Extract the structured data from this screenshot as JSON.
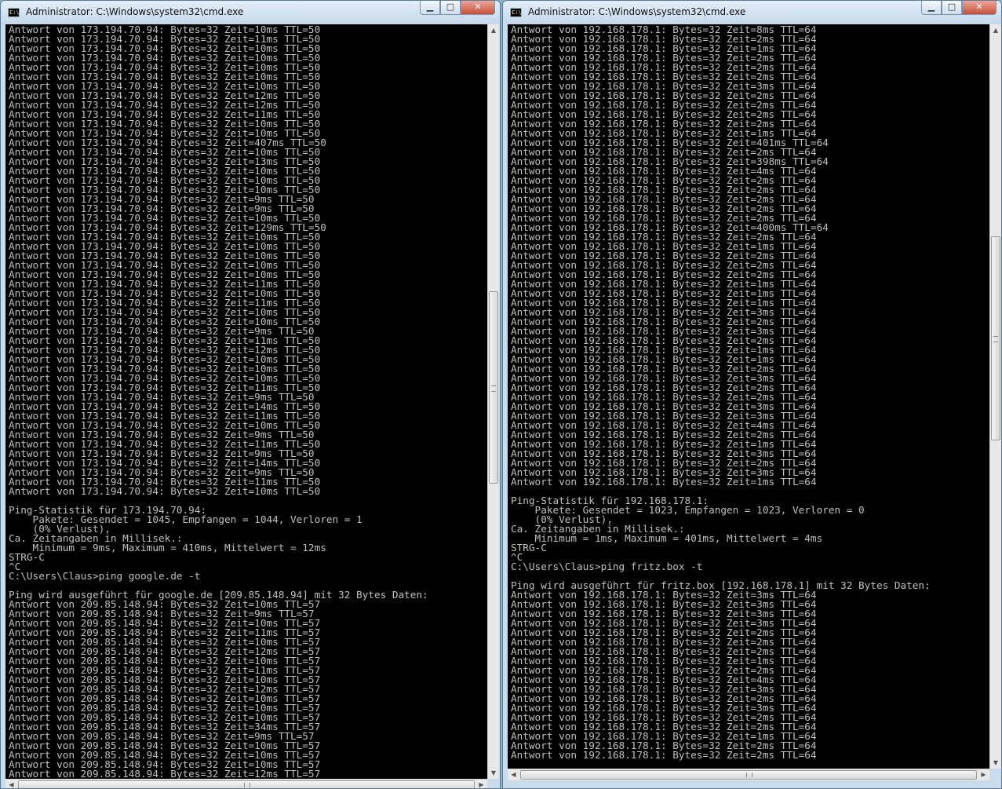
{
  "left": {
    "title": "Administrator: C:\\Windows\\system32\\cmd.exe",
    "lines": [
      "Antwort von 173.194.70.94: Bytes=32 Zeit=10ms TTL=50",
      "Antwort von 173.194.70.94: Bytes=32 Zeit=11ms TTL=50",
      "Antwort von 173.194.70.94: Bytes=32 Zeit=10ms TTL=50",
      "Antwort von 173.194.70.94: Bytes=32 Zeit=10ms TTL=50",
      "Antwort von 173.194.70.94: Bytes=32 Zeit=10ms TTL=50",
      "Antwort von 173.194.70.94: Bytes=32 Zeit=10ms TTL=50",
      "Antwort von 173.194.70.94: Bytes=32 Zeit=10ms TTL=50",
      "Antwort von 173.194.70.94: Bytes=32 Zeit=12ms TTL=50",
      "Antwort von 173.194.70.94: Bytes=32 Zeit=12ms TTL=50",
      "Antwort von 173.194.70.94: Bytes=32 Zeit=11ms TTL=50",
      "Antwort von 173.194.70.94: Bytes=32 Zeit=10ms TTL=50",
      "Antwort von 173.194.70.94: Bytes=32 Zeit=10ms TTL=50",
      "Antwort von 173.194.70.94: Bytes=32 Zeit=407ms TTL=50",
      "Antwort von 173.194.70.94: Bytes=32 Zeit=10ms TTL=50",
      "Antwort von 173.194.70.94: Bytes=32 Zeit=13ms TTL=50",
      "Antwort von 173.194.70.94: Bytes=32 Zeit=10ms TTL=50",
      "Antwort von 173.194.70.94: Bytes=32 Zeit=10ms TTL=50",
      "Antwort von 173.194.70.94: Bytes=32 Zeit=10ms TTL=50",
      "Antwort von 173.194.70.94: Bytes=32 Zeit=9ms TTL=50",
      "Antwort von 173.194.70.94: Bytes=32 Zeit=9ms TTL=50",
      "Antwort von 173.194.70.94: Bytes=32 Zeit=10ms TTL=50",
      "Antwort von 173.194.70.94: Bytes=32 Zeit=129ms TTL=50",
      "Antwort von 173.194.70.94: Bytes=32 Zeit=10ms TTL=50",
      "Antwort von 173.194.70.94: Bytes=32 Zeit=10ms TTL=50",
      "Antwort von 173.194.70.94: Bytes=32 Zeit=10ms TTL=50",
      "Antwort von 173.194.70.94: Bytes=32 Zeit=10ms TTL=50",
      "Antwort von 173.194.70.94: Bytes=32 Zeit=10ms TTL=50",
      "Antwort von 173.194.70.94: Bytes=32 Zeit=11ms TTL=50",
      "Antwort von 173.194.70.94: Bytes=32 Zeit=10ms TTL=50",
      "Antwort von 173.194.70.94: Bytes=32 Zeit=11ms TTL=50",
      "Antwort von 173.194.70.94: Bytes=32 Zeit=10ms TTL=50",
      "Antwort von 173.194.70.94: Bytes=32 Zeit=10ms TTL=50",
      "Antwort von 173.194.70.94: Bytes=32 Zeit=9ms TTL=50",
      "Antwort von 173.194.70.94: Bytes=32 Zeit=11ms TTL=50",
      "Antwort von 173.194.70.94: Bytes=32 Zeit=12ms TTL=50",
      "Antwort von 173.194.70.94: Bytes=32 Zeit=10ms TTL=50",
      "Antwort von 173.194.70.94: Bytes=32 Zeit=10ms TTL=50",
      "Antwort von 173.194.70.94: Bytes=32 Zeit=10ms TTL=50",
      "Antwort von 173.194.70.94: Bytes=32 Zeit=11ms TTL=50",
      "Antwort von 173.194.70.94: Bytes=32 Zeit=9ms TTL=50",
      "Antwort von 173.194.70.94: Bytes=32 Zeit=14ms TTL=50",
      "Antwort von 173.194.70.94: Bytes=32 Zeit=11ms TTL=50",
      "Antwort von 173.194.70.94: Bytes=32 Zeit=10ms TTL=50",
      "Antwort von 173.194.70.94: Bytes=32 Zeit=9ms TTL=50",
      "Antwort von 173.194.70.94: Bytes=32 Zeit=11ms TTL=50",
      "Antwort von 173.194.70.94: Bytes=32 Zeit=9ms TTL=50",
      "Antwort von 173.194.70.94: Bytes=32 Zeit=14ms TTL=50",
      "Antwort von 173.194.70.94: Bytes=32 Zeit=9ms TTL=50",
      "Antwort von 173.194.70.94: Bytes=32 Zeit=11ms TTL=50",
      "Antwort von 173.194.70.94: Bytes=32 Zeit=10ms TTL=50",
      "",
      "Ping-Statistik für 173.194.70.94:",
      "    Pakete: Gesendet = 1045, Empfangen = 1044, Verloren = 1",
      "    (0% Verlust),",
      "Ca. Zeitangaben in Millisek.:",
      "    Minimum = 9ms, Maximum = 410ms, Mittelwert = 12ms",
      "STRG-C",
      "^C",
      "C:\\Users\\Claus>ping google.de -t",
      "",
      "Ping wird ausgeführt für google.de [209.85.148.94] mit 32 Bytes Daten:",
      "Antwort von 209.85.148.94: Bytes=32 Zeit=10ms TTL=57",
      "Antwort von 209.85.148.94: Bytes=32 Zeit=9ms TTL=57",
      "Antwort von 209.85.148.94: Bytes=32 Zeit=10ms TTL=57",
      "Antwort von 209.85.148.94: Bytes=32 Zeit=11ms TTL=57",
      "Antwort von 209.85.148.94: Bytes=32 Zeit=10ms TTL=57",
      "Antwort von 209.85.148.94: Bytes=32 Zeit=12ms TTL=57",
      "Antwort von 209.85.148.94: Bytes=32 Zeit=10ms TTL=57",
      "Antwort von 209.85.148.94: Bytes=32 Zeit=11ms TTL=57",
      "Antwort von 209.85.148.94: Bytes=32 Zeit=10ms TTL=57",
      "Antwort von 209.85.148.94: Bytes=32 Zeit=12ms TTL=57",
      "Antwort von 209.85.148.94: Bytes=32 Zeit=10ms TTL=57",
      "Antwort von 209.85.148.94: Bytes=32 Zeit=10ms TTL=57",
      "Antwort von 209.85.148.94: Bytes=32 Zeit=10ms TTL=57",
      "Antwort von 209.85.148.94: Bytes=32 Zeit=34ms TTL=57",
      "Antwort von 209.85.148.94: Bytes=32 Zeit=9ms TTL=57",
      "Antwort von 209.85.148.94: Bytes=32 Zeit=10ms TTL=57",
      "Antwort von 209.85.148.94: Bytes=32 Zeit=10ms TTL=57",
      "Antwort von 209.85.148.94: Bytes=32 Zeit=10ms TTL=57",
      "Antwort von 209.85.148.94: Bytes=32 Zeit=12ms TTL=57"
    ]
  },
  "right": {
    "title": "Administrator: C:\\Windows\\system32\\cmd.exe",
    "lines": [
      "Antwort von 192.168.178.1: Bytes=32 Zeit=8ms TTL=64",
      "Antwort von 192.168.178.1: Bytes=32 Zeit=2ms TTL=64",
      "Antwort von 192.168.178.1: Bytes=32 Zeit=1ms TTL=64",
      "Antwort von 192.168.178.1: Bytes=32 Zeit=2ms TTL=64",
      "Antwort von 192.168.178.1: Bytes=32 Zeit=2ms TTL=64",
      "Antwort von 192.168.178.1: Bytes=32 Zeit=2ms TTL=64",
      "Antwort von 192.168.178.1: Bytes=32 Zeit=3ms TTL=64",
      "Antwort von 192.168.178.1: Bytes=32 Zeit=2ms TTL=64",
      "Antwort von 192.168.178.1: Bytes=32 Zeit=2ms TTL=64",
      "Antwort von 192.168.178.1: Bytes=32 Zeit=2ms TTL=64",
      "Antwort von 192.168.178.1: Bytes=32 Zeit=2ms TTL=64",
      "Antwort von 192.168.178.1: Bytes=32 Zeit=1ms TTL=64",
      "Antwort von 192.168.178.1: Bytes=32 Zeit=401ms TTL=64",
      "Antwort von 192.168.178.1: Bytes=32 Zeit=2ms TTL=64",
      "Antwort von 192.168.178.1: Bytes=32 Zeit=398ms TTL=64",
      "Antwort von 192.168.178.1: Bytes=32 Zeit=4ms TTL=64",
      "Antwort von 192.168.178.1: Bytes=32 Zeit=2ms TTL=64",
      "Antwort von 192.168.178.1: Bytes=32 Zeit=2ms TTL=64",
      "Antwort von 192.168.178.1: Bytes=32 Zeit=2ms TTL=64",
      "Antwort von 192.168.178.1: Bytes=32 Zeit=2ms TTL=64",
      "Antwort von 192.168.178.1: Bytes=32 Zeit=2ms TTL=64",
      "Antwort von 192.168.178.1: Bytes=32 Zeit=400ms TTL=64",
      "Antwort von 192.168.178.1: Bytes=32 Zeit=2ms TTL=64",
      "Antwort von 192.168.178.1: Bytes=32 Zeit=1ms TTL=64",
      "Antwort von 192.168.178.1: Bytes=32 Zeit=2ms TTL=64",
      "Antwort von 192.168.178.1: Bytes=32 Zeit=2ms TTL=64",
      "Antwort von 192.168.178.1: Bytes=32 Zeit=2ms TTL=64",
      "Antwort von 192.168.178.1: Bytes=32 Zeit=1ms TTL=64",
      "Antwort von 192.168.178.1: Bytes=32 Zeit=1ms TTL=64",
      "Antwort von 192.168.178.1: Bytes=32 Zeit=1ms TTL=64",
      "Antwort von 192.168.178.1: Bytes=32 Zeit=3ms TTL=64",
      "Antwort von 192.168.178.1: Bytes=32 Zeit=2ms TTL=64",
      "Antwort von 192.168.178.1: Bytes=32 Zeit=3ms TTL=64",
      "Antwort von 192.168.178.1: Bytes=32 Zeit=2ms TTL=64",
      "Antwort von 192.168.178.1: Bytes=32 Zeit=1ms TTL=64",
      "Antwort von 192.168.178.1: Bytes=32 Zeit=1ms TTL=64",
      "Antwort von 192.168.178.1: Bytes=32 Zeit=2ms TTL=64",
      "Antwort von 192.168.178.1: Bytes=32 Zeit=3ms TTL=64",
      "Antwort von 192.168.178.1: Bytes=32 Zeit=2ms TTL=64",
      "Antwort von 192.168.178.1: Bytes=32 Zeit=2ms TTL=64",
      "Antwort von 192.168.178.1: Bytes=32 Zeit=3ms TTL=64",
      "Antwort von 192.168.178.1: Bytes=32 Zeit=3ms TTL=64",
      "Antwort von 192.168.178.1: Bytes=32 Zeit=4ms TTL=64",
      "Antwort von 192.168.178.1: Bytes=32 Zeit=2ms TTL=64",
      "Antwort von 192.168.178.1: Bytes=32 Zeit=1ms TTL=64",
      "Antwort von 192.168.178.1: Bytes=32 Zeit=3ms TTL=64",
      "Antwort von 192.168.178.1: Bytes=32 Zeit=2ms TTL=64",
      "Antwort von 192.168.178.1: Bytes=32 Zeit=3ms TTL=64",
      "Antwort von 192.168.178.1: Bytes=32 Zeit=1ms TTL=64",
      "",
      "Ping-Statistik für 192.168.178.1:",
      "    Pakete: Gesendet = 1023, Empfangen = 1023, Verloren = 0",
      "    (0% Verlust),",
      "Ca. Zeitangaben in Millisek.:",
      "    Minimum = 1ms, Maximum = 401ms, Mittelwert = 4ms",
      "STRG-C",
      "^C",
      "C:\\Users\\Claus>ping fritz.box -t",
      "",
      "Ping wird ausgeführt für fritz.box [192.168.178.1] mit 32 Bytes Daten:",
      "Antwort von 192.168.178.1: Bytes=32 Zeit=3ms TTL=64",
      "Antwort von 192.168.178.1: Bytes=32 Zeit=3ms TTL=64",
      "Antwort von 192.168.178.1: Bytes=32 Zeit=3ms TTL=64",
      "Antwort von 192.168.178.1: Bytes=32 Zeit=3ms TTL=64",
      "Antwort von 192.168.178.1: Bytes=32 Zeit=2ms TTL=64",
      "Antwort von 192.168.178.1: Bytes=32 Zeit=2ms TTL=64",
      "Antwort von 192.168.178.1: Bytes=32 Zeit=2ms TTL=64",
      "Antwort von 192.168.178.1: Bytes=32 Zeit=1ms TTL=64",
      "Antwort von 192.168.178.1: Bytes=32 Zeit=2ms TTL=64",
      "Antwort von 192.168.178.1: Bytes=32 Zeit=4ms TTL=64",
      "Antwort von 192.168.178.1: Bytes=32 Zeit=3ms TTL=64",
      "Antwort von 192.168.178.1: Bytes=32 Zeit=2ms TTL=64",
      "Antwort von 192.168.178.1: Bytes=32 Zeit=3ms TTL=64",
      "Antwort von 192.168.178.1: Bytes=32 Zeit=2ms TTL=64",
      "Antwort von 192.168.178.1: Bytes=32 Zeit=2ms TTL=64",
      "Antwort von 192.168.178.1: Bytes=32 Zeit=1ms TTL=64",
      "Antwort von 192.168.178.1: Bytes=32 Zeit=2ms TTL=64",
      "Antwort von 192.168.178.1: Bytes=32 Zeit=2ms TTL=64"
    ]
  },
  "colors": {
    "console_bg": "#000000",
    "console_text": "#c0c0c0",
    "titlebar": "#c9dcec",
    "close_button": "#c7503b"
  },
  "icons": {
    "app": "cmd-icon",
    "minimize": "minimize-icon",
    "maximize": "maximize-icon",
    "close": "close-icon",
    "scroll_up": "arrow-up-icon",
    "scroll_down": "arrow-down-icon",
    "scroll_left": "arrow-left-icon",
    "scroll_right": "arrow-right-icon"
  }
}
